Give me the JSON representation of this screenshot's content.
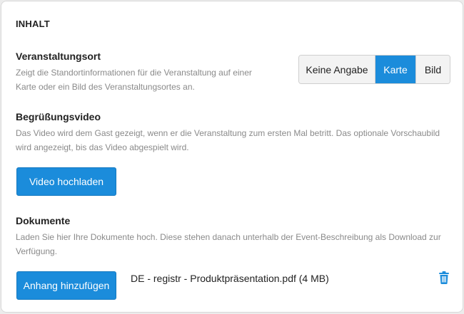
{
  "content": {
    "section_title": "INHALT",
    "location": {
      "heading": "Veranstaltungsort",
      "description_line1": "Zeigt die Standortinformationen für die Veranstaltung auf einer",
      "description_line2": "Karte oder ein Bild des Veranstaltungsortes an.",
      "options": [
        "Keine Angabe",
        "Karte",
        "Bild"
      ],
      "selected": "Karte"
    },
    "welcome_video": {
      "heading": "Begrüßungsvideo",
      "description_line1": "Das Video wird dem Gast gezeigt, wenn er die Veranstaltung zum ersten Mal betritt. Das optionale Vorschaubild",
      "description_line2": "wird angezeigt, bis das Video abgespielt wird.",
      "upload_label": "Video hochladen"
    },
    "documents": {
      "heading": "Dokumente",
      "description_line1": "Laden Sie hier Ihre Dokumente hoch. Diese stehen danach unterhalb der Event-Beschreibung als Download zur",
      "description_line2": "Verfügung.",
      "add_label": "Anhang hinzufügen",
      "files": [
        {
          "name": "DE - registr - Produktpräsentation.pdf (4 MB)",
          "delete_icon": "trash-icon"
        }
      ]
    }
  },
  "colors": {
    "accent": "#1b8cdb",
    "muted_text": "#8a8a8a"
  }
}
